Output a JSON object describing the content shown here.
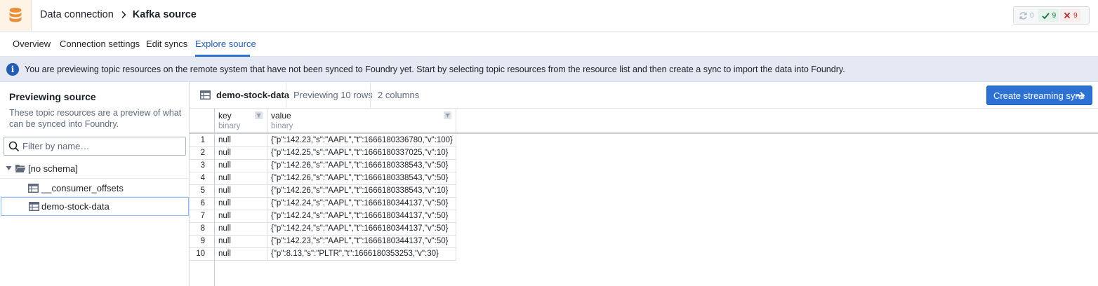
{
  "header": {
    "breadcrumb_parent": "Data connection",
    "breadcrumb_current": "Kafka source",
    "status": {
      "syncing": "0",
      "succeeded": "9",
      "failed": "9"
    }
  },
  "tabs": [
    {
      "label": "Overview"
    },
    {
      "label": "Connection settings"
    },
    {
      "label": "Edit syncs"
    },
    {
      "label": "Explore source",
      "active": true
    }
  ],
  "callout": {
    "text": "You are previewing topic resources on the remote system that have not been synced to Foundry yet. Start by selecting topic resources from the resource list and then create a sync to import the data into Foundry."
  },
  "sidebar": {
    "title": "Previewing source",
    "description": "These topic resources are a preview of what can be synced into Foundry.",
    "filter_placeholder": "Filter by name…",
    "schema_label": "[no schema]",
    "items": [
      {
        "label": "__consumer_offsets"
      },
      {
        "label": "demo-stock-data",
        "selected": true
      }
    ]
  },
  "main": {
    "dataset_name": "demo-stock-data",
    "rows_label": "Previewing 10 rows",
    "cols_label": "2 columns",
    "create_button": "Create streaming sync",
    "columns": [
      {
        "name": "key",
        "type": "binary"
      },
      {
        "name": "value",
        "type": "binary"
      }
    ],
    "rows": [
      {
        "n": "1",
        "key": "null",
        "value": "{\"p\":142.23,\"s\":\"AAPL\",\"t\":1666180336780,\"v\":100}"
      },
      {
        "n": "2",
        "key": "null",
        "value": "{\"p\":142.25,\"s\":\"AAPL\",\"t\":1666180337025,\"v\":10}"
      },
      {
        "n": "3",
        "key": "null",
        "value": "{\"p\":142.26,\"s\":\"AAPL\",\"t\":1666180338543,\"v\":50}"
      },
      {
        "n": "4",
        "key": "null",
        "value": "{\"p\":142.26,\"s\":\"AAPL\",\"t\":1666180338543,\"v\":50}"
      },
      {
        "n": "5",
        "key": "null",
        "value": "{\"p\":142.26,\"s\":\"AAPL\",\"t\":1666180338543,\"v\":10}"
      },
      {
        "n": "6",
        "key": "null",
        "value": "{\"p\":142.24,\"s\":\"AAPL\",\"t\":1666180344137,\"v\":50}"
      },
      {
        "n": "7",
        "key": "null",
        "value": "{\"p\":142.24,\"s\":\"AAPL\",\"t\":1666180344137,\"v\":50}"
      },
      {
        "n": "8",
        "key": "null",
        "value": "{\"p\":142.24,\"s\":\"AAPL\",\"t\":1666180344137,\"v\":50}"
      },
      {
        "n": "9",
        "key": "null",
        "value": "{\"p\":142.23,\"s\":\"AAPL\",\"t\":1666180344137,\"v\":50}"
      },
      {
        "n": "10",
        "key": "null",
        "value": "{\"p\":8.13,\"s\":\"PLTR\",\"t\":1666180353253,\"v\":30}"
      }
    ]
  }
}
